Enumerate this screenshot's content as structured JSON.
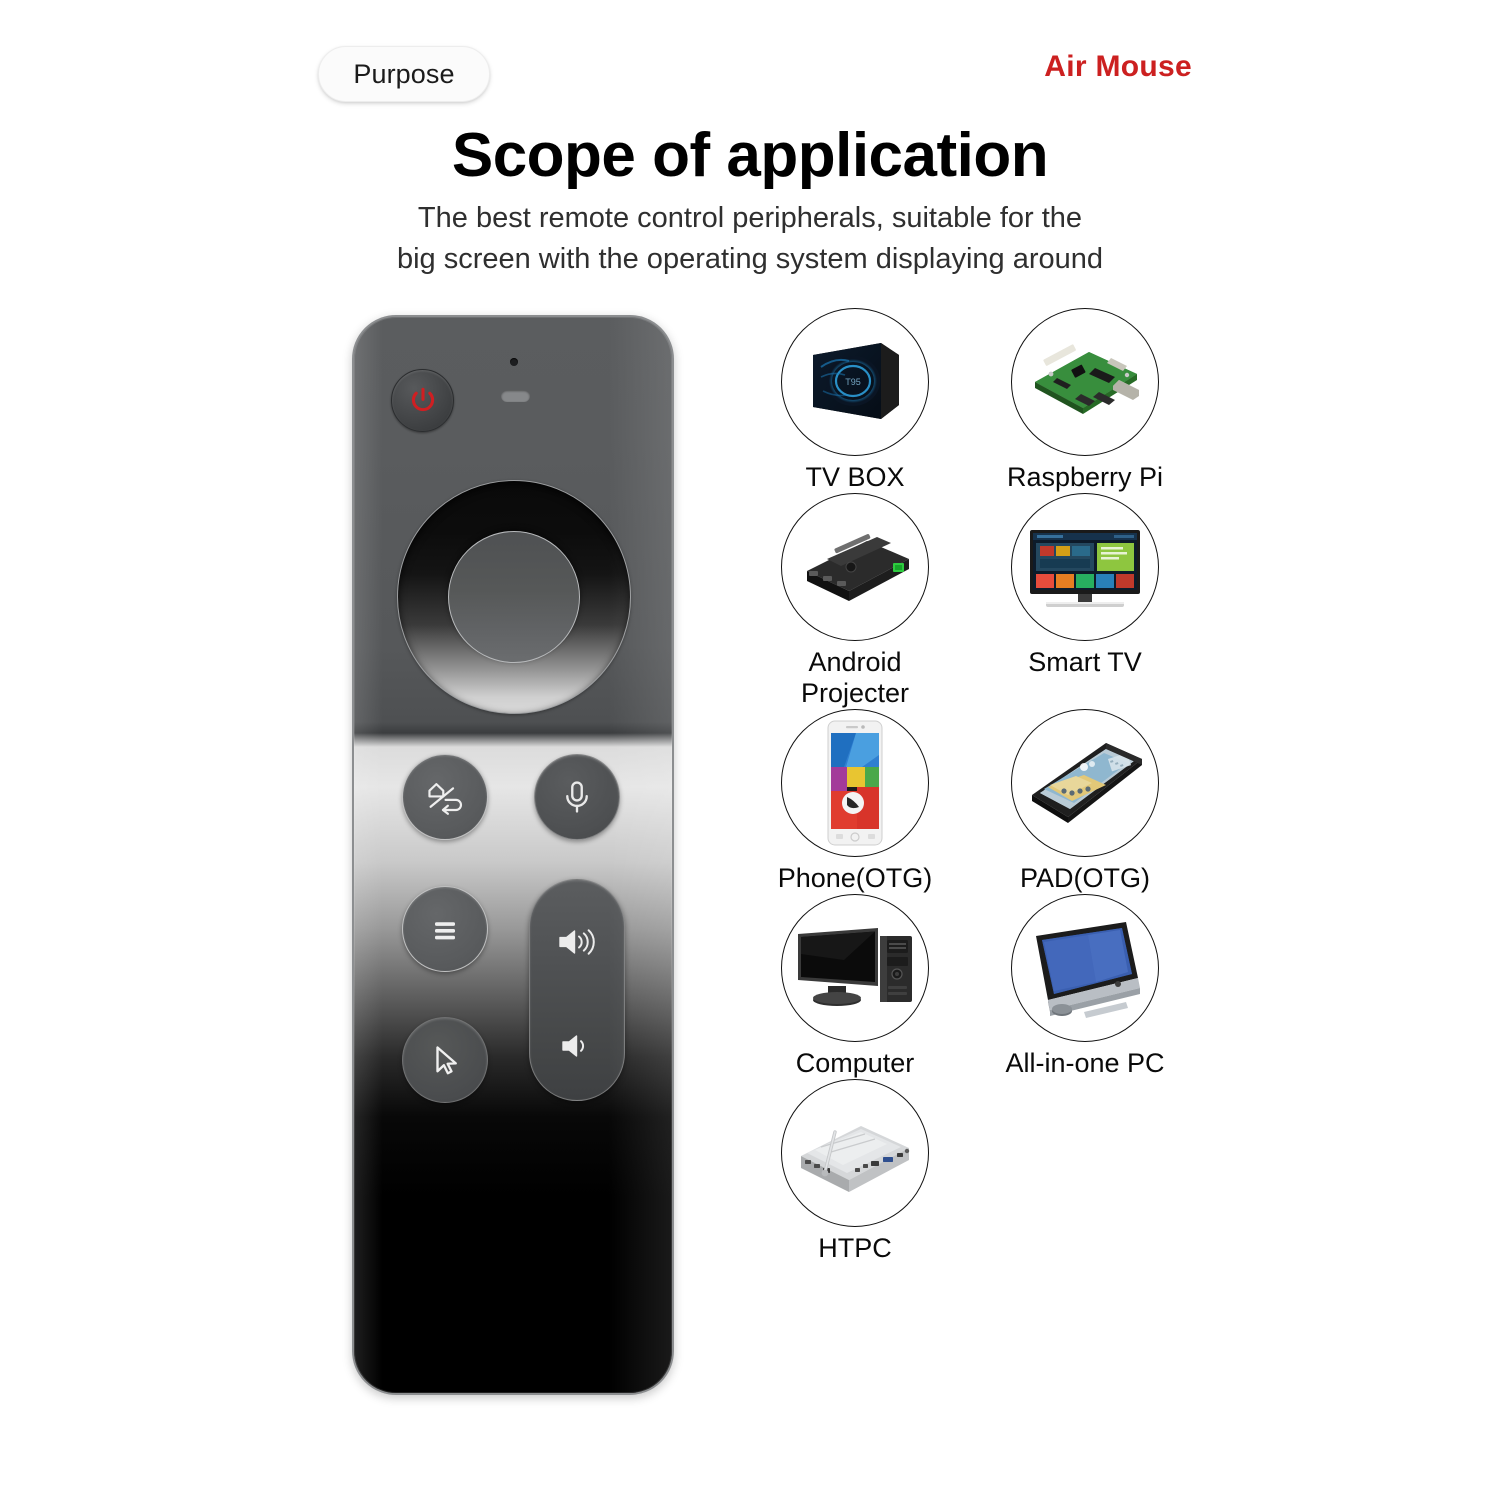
{
  "header": {
    "badge": "Purpose",
    "brand": "Air Mouse",
    "title": "Scope of application",
    "subtitle_line1": "The best remote control peripherals, suitable for the",
    "subtitle_line2": "big screen with the operating system displaying around",
    "brand_color": "#cc2020",
    "title_color": "#000000"
  },
  "remote": {
    "name": "air-mouse-remote",
    "buttons": [
      {
        "id": "power",
        "icon": "power-icon",
        "color": "#cc2020"
      },
      {
        "id": "dpad",
        "icon": "dpad-ring-icon"
      },
      {
        "id": "ok",
        "icon": "ok-center-icon"
      },
      {
        "id": "home-back",
        "icon": "home-back-icon"
      },
      {
        "id": "voice",
        "icon": "microphone-icon"
      },
      {
        "id": "menu",
        "icon": "hamburger-menu-icon"
      },
      {
        "id": "air-mouse",
        "icon": "mouse-cursor-icon"
      },
      {
        "id": "volume-up",
        "icon": "volume-up-icon"
      },
      {
        "id": "volume-down",
        "icon": "volume-down-icon"
      }
    ],
    "indicators": [
      {
        "id": "led",
        "icon": "led-dot-icon"
      },
      {
        "id": "mic-hole",
        "icon": "microphone-slot-icon"
      }
    ]
  },
  "devices": {
    "rows": [
      [
        {
          "label": "TV BOX",
          "icon": "tv-box-icon"
        },
        {
          "label": "Raspberry Pi",
          "icon": "raspberry-pi-icon"
        }
      ],
      [
        {
          "label": "Android\nProjecter",
          "icon": "android-projector-icon"
        },
        {
          "label": "Smart TV",
          "icon": "smart-tv-icon"
        }
      ],
      [
        {
          "label": "Phone(OTG)",
          "icon": "smartphone-icon"
        },
        {
          "label": "PAD(OTG)",
          "icon": "tablet-icon"
        }
      ],
      [
        {
          "label": "Computer",
          "icon": "desktop-computer-icon"
        },
        {
          "label": "All-in-one PC",
          "icon": "all-in-one-pc-icon"
        }
      ],
      [
        {
          "label": "HTPC",
          "icon": "htpc-mini-pc-icon"
        }
      ]
    ]
  }
}
